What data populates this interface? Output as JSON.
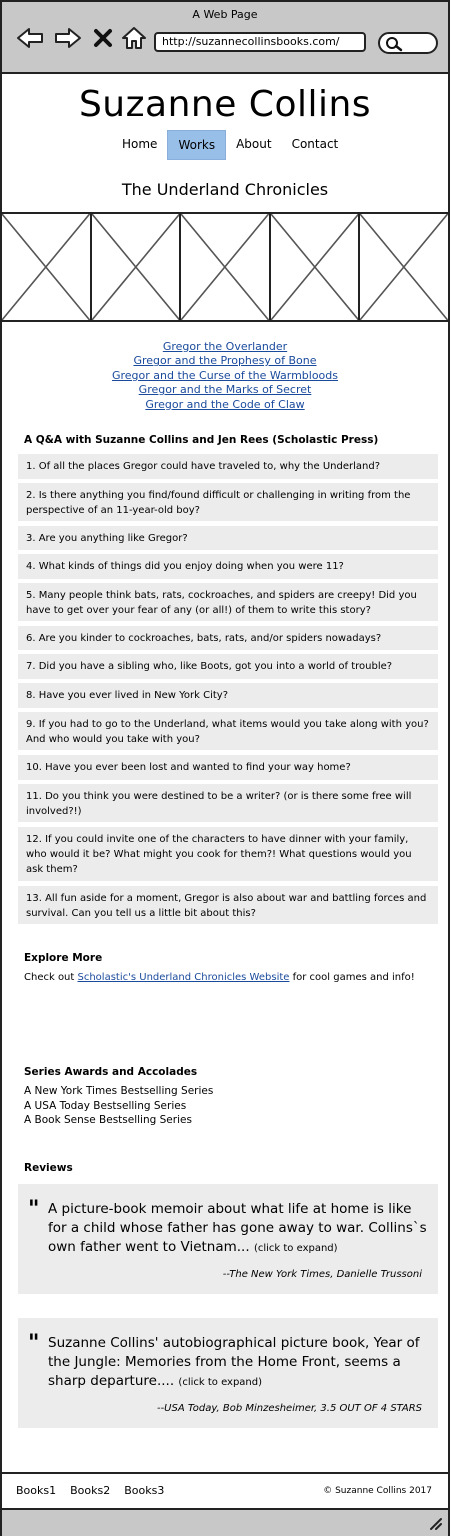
{
  "browser": {
    "window_title": "A Web Page",
    "url": "http://suzannecollinsbooks.com/"
  },
  "site": {
    "title": "Suzanne Collins",
    "nav": [
      "Home",
      "Works",
      "About",
      "Contact"
    ],
    "active_nav": "Works",
    "section_title": "The Underland Chronicles"
  },
  "books": [
    "Gregor the Overlander",
    "Gregor and the Prophesy of Bone",
    "Gregor and the Curse of the Warmbloods",
    "Gregor and the Marks of Secret",
    "Gregor and the Code of Claw"
  ],
  "qa": {
    "heading": "A Q&A with Suzanne Collins and Jen Rees (Scholastic Press)",
    "questions": [
      "1. Of all the places Gregor could have traveled to, why the Underland?",
      "2. Is there anything you find/found difficult or challenging in writing from the perspective of an 11-year-old boy?",
      "3. Are you anything like Gregor?",
      "4. What kinds of things did you enjoy doing when you were 11?",
      "5. Many people think bats, rats, cockroaches, and spiders are creepy! Did you have to get over your fear of any (or all!) of them to write this story?",
      "6. Are you kinder to cockroaches, bats, rats, and/or spiders nowadays?",
      "7. Did you have a sibling who, like Boots, got you into a world of trouble?",
      "8. Have you ever lived in New York City?",
      "9. If you had to go to the Underland, what items would you take along with you? And who would you take with you?",
      "10. Have you ever been lost and wanted to find your way home?",
      "11. Do you think you were destined to be a writer? (or is there some free will involved?!)",
      "12. If you could invite one of the characters to have dinner with your family, who would it be? What might you cook for them?! What questions would you ask them?",
      "13. All fun aside for a moment, Gregor is also about war and battling forces and survival. Can you tell us a little bit about this?"
    ]
  },
  "explore": {
    "heading": "Explore More",
    "prefix": "Check out ",
    "link": "Scholastic's Underland Chronicles Website",
    "suffix": " for cool games and info!"
  },
  "awards": {
    "heading": "Series Awards and Accolades",
    "items": [
      "A New York Times Bestselling Series",
      "A USA Today Bestselling Series",
      "A Book Sense Bestselling Series"
    ]
  },
  "reviews": {
    "heading": "Reviews",
    "quote_mark": "\"",
    "expand_label": "(click to expand)",
    "items": [
      {
        "text": "A picture-book memoir about what life at home is like for a child whose father has gone away to war. Collins`s own father went to Vietnam...",
        "source": "--The New York Times, Danielle Trussoni"
      },
      {
        "text": "Suzanne Collins' autobiographical picture book, Year of the Jungle: Memories from the Home Front, seems a sharp departure....",
        "source": "--USA Today, Bob Minzesheimer, 3.5 OUT OF 4 STARS"
      }
    ]
  },
  "footer": {
    "links": [
      "Books1",
      "Books2",
      "Books3"
    ],
    "copyright": "© Suzanne Collins 2017"
  }
}
